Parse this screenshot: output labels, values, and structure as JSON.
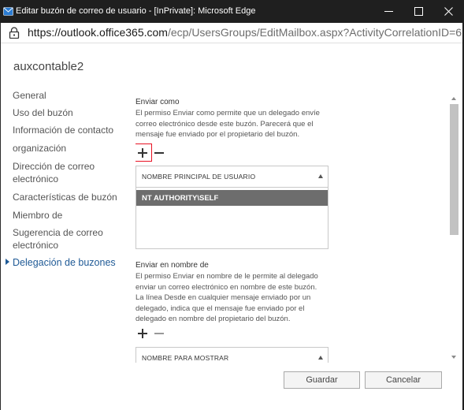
{
  "window": {
    "title": "Editar buzón de correo de usuario - [InPrivate]: Microsoft Edge",
    "url_host": "https://outlook.office365.com",
    "url_path": "/ecp/UsersGroups/EditMailbox.aspx?ActivityCorrelationID=6..."
  },
  "mailbox_name": "auxcontable2",
  "nav": {
    "items": [
      {
        "label": "General"
      },
      {
        "label": "Uso del buzón"
      },
      {
        "label": "Información de contacto"
      },
      {
        "label": "organización"
      },
      {
        "label": "Dirección de correo electrónico"
      },
      {
        "label": "Características de buzón"
      },
      {
        "label": "Miembro de"
      },
      {
        "label": "Sugerencia de correo electrónico"
      },
      {
        "label": "Delegación de buzones"
      }
    ],
    "active": "Delegación de buzones"
  },
  "send_as": {
    "title": "Enviar como",
    "description": "El permiso Enviar como permite que un delegado envíe correo electrónico desde este buzón. Parecerá que el mensaje fue enviado por el propietario del buzón.",
    "column_header": "NOMBRE PRINCIPAL DE USUARIO",
    "rows": [
      "NT AUTHORITY\\SELF"
    ]
  },
  "send_on_behalf": {
    "title": "Enviar en nombre de",
    "description": "El permiso Enviar en nombre de le permite al delegado enviar un correo electrónico en nombre de este buzón. La línea Desde en cualquier mensaje enviado por un delegado, indica que el mensaje fue enviado por el delegado en nombre del propietario del buzón.",
    "column_header": "NOMBRE PARA MOSTRAR"
  },
  "buttons": {
    "save": "Guardar",
    "cancel": "Cancelar"
  },
  "colors": {
    "titlebar": "#1f1f1f",
    "active_nav": "#1f5a96",
    "selected_row": "#6d6d6d",
    "highlight_box": "#e81123"
  }
}
